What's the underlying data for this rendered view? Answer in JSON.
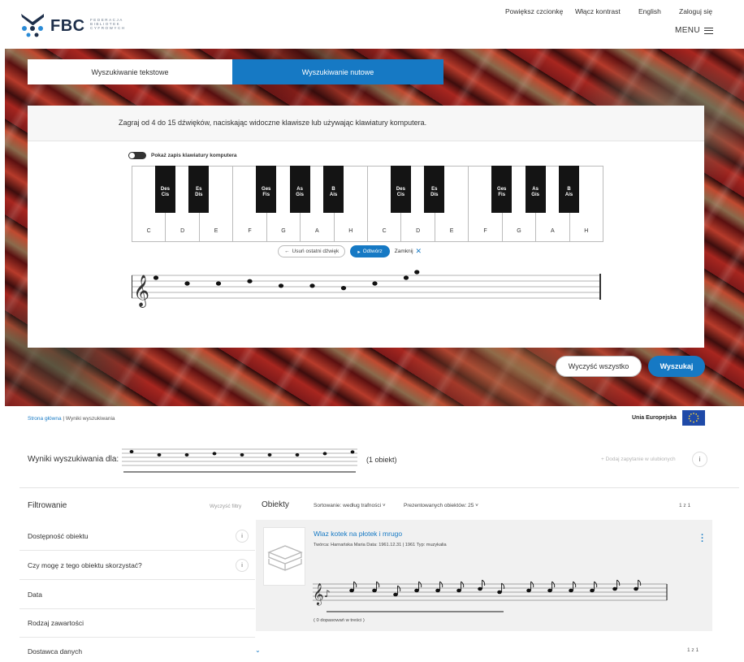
{
  "header": {
    "logo_text": "FBC",
    "logo_sub": "FEDERACJA\nBIBLIOTEK\nCYFROWYCH",
    "links": [
      "Powiększ czcionkę",
      "Włącz kontrast",
      "English",
      "Zaloguj się"
    ],
    "menu_label": "MENU"
  },
  "search": {
    "tabs": [
      {
        "label": "Wyszukiwanie tekstowe",
        "active": false
      },
      {
        "label": "Wyszukiwanie nutowe",
        "active": true
      }
    ],
    "instructions": "Zagraj od 4 do 15 dźwięków, naciskając widoczne klawisze lub używając klawiatury komputera.",
    "toggle_label": "Pokaż zapis klawiatury komputera",
    "white_keys": [
      "C",
      "D",
      "E",
      "F",
      "G",
      "A",
      "H",
      "C",
      "D",
      "E",
      "F",
      "G",
      "A",
      "H"
    ],
    "black_keys": [
      "Des\nCis",
      "Es\nDis",
      "Ges\nFis",
      "As\nGis",
      "B\nAis",
      "Des\nCis",
      "Es\nDis",
      "Ges\nFis",
      "As\nGis",
      "B\nAis"
    ],
    "undo_label": "Usuń ostatni dźwięk",
    "play_label": "Odtwórz",
    "close_label": "Zamknij",
    "clear_all_label": "Wyczyść wszystko",
    "search_label": "Wyszukaj",
    "accent_color": "#1679c4"
  },
  "breadcrumb": {
    "home": "Strona główna",
    "current": "Wyniki wyszukiwania"
  },
  "eu_label": "Unia Europejska",
  "results": {
    "label": "Wyniki wyszukiwania dla:",
    "count": "(1 obiekt)",
    "add_favorite": "+ Dodaj zapytanie w ulubionych",
    "info": "i"
  },
  "filters": {
    "title": "Filtrowanie",
    "clear": "Wyczyść filtry",
    "items": [
      {
        "label": "Dostępność obiektu",
        "info": "i"
      },
      {
        "label": "Czy mogę z tego obiektu skorzystać?",
        "info": "i"
      },
      {
        "label": "Data"
      },
      {
        "label": "Rodzaj zawartości"
      },
      {
        "label": "Dostawca danych"
      }
    ]
  },
  "objects": {
    "title": "Obiekty",
    "sort": "Sortowanie: według trafności",
    "per_page": "Prezentowanych obiektów: 25",
    "pager_top": "1 z 1",
    "pager_bottom": "1 z 1",
    "items": [
      {
        "title": "Wlaz kotek na płotek i mrugo",
        "meta": "Twórca: Harnańska Maria    Data: 1961.12.31 | 1961    Typ: muzykalia",
        "matches": "( 0 dopasowań w treści )"
      }
    ]
  }
}
